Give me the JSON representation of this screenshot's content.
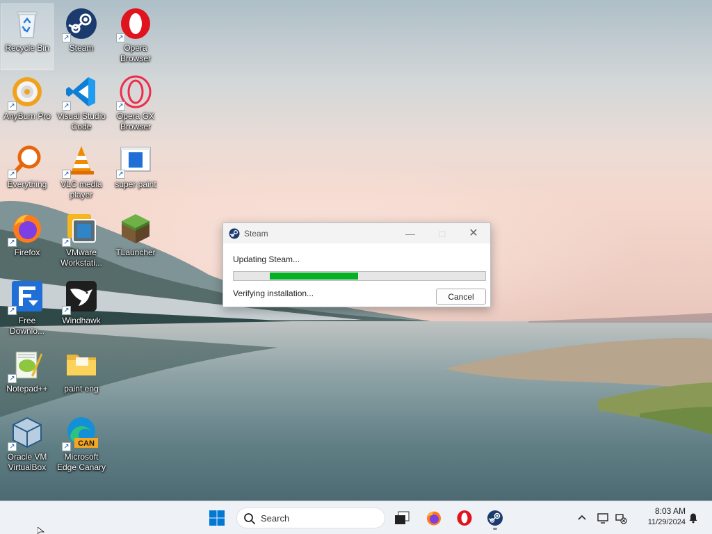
{
  "desktop_icons": [
    {
      "label": "Recycle Bin",
      "icon": "recycle-bin-icon",
      "shortcut": false
    },
    {
      "label": "Steam",
      "icon": "steam-icon",
      "shortcut": true
    },
    {
      "label": "Opera Browser",
      "icon": "opera-icon",
      "shortcut": true
    },
    {
      "label": "AnyBurn Pro",
      "icon": "anyburn-icon",
      "shortcut": true
    },
    {
      "label": "Visual Studio Code",
      "icon": "vscode-icon",
      "shortcut": true
    },
    {
      "label": "Opera GX Browser",
      "icon": "opera-gx-icon",
      "shortcut": true
    },
    {
      "label": "Everything",
      "icon": "everything-search-icon",
      "shortcut": true
    },
    {
      "label": "VLC media player",
      "icon": "vlc-icon",
      "shortcut": true
    },
    {
      "label": "super paint",
      "icon": "super-paint-icon",
      "shortcut": true
    },
    {
      "label": "Firefox",
      "icon": "firefox-icon",
      "shortcut": true
    },
    {
      "label": "VMware Workstati...",
      "icon": "vmware-icon",
      "shortcut": true
    },
    {
      "label": "TLauncher",
      "icon": "tlauncher-icon",
      "shortcut": true
    },
    {
      "label": "Free Downlo...",
      "icon": "free-download-manager-icon",
      "shortcut": true
    },
    {
      "label": "Windhawk",
      "icon": "windhawk-icon",
      "shortcut": true
    },
    {
      "label": "Notepad++",
      "icon": "notepad-plus-plus-icon",
      "shortcut": true
    },
    {
      "label": "paint eng",
      "icon": "folder-icon",
      "shortcut": false
    },
    {
      "label": "Oracle VM VirtualBox",
      "icon": "virtualbox-icon",
      "shortcut": true
    },
    {
      "label": "Microsoft Edge Canary",
      "icon": "edge-canary-icon",
      "shortcut": true,
      "badge": "CAN"
    }
  ],
  "steam_dialog": {
    "title": "Steam",
    "status": "Updating Steam...",
    "detail": "Verifying installation...",
    "cancel_label": "Cancel",
    "progress_start_fraction": 0.145,
    "progress_end_fraction": 0.495,
    "progress_color": "#06b025"
  },
  "taskbar": {
    "search_label": "Search",
    "pinned": [
      {
        "name": "start",
        "icon": "windows-start-icon"
      },
      {
        "name": "task-view",
        "icon": "task-view-icon"
      },
      {
        "name": "firefox",
        "icon": "firefox-icon"
      },
      {
        "name": "opera",
        "icon": "opera-icon"
      },
      {
        "name": "steam",
        "icon": "steam-icon",
        "running": true
      }
    ],
    "tray_icons": [
      "chevron-up-icon",
      "display-icon",
      "network-disconnected-icon",
      "bell-icon"
    ],
    "time": "8:03 AM",
    "date": "11/29/2024"
  },
  "colors": {
    "accent": "#0078d4",
    "steam_blue": "#1b2838",
    "progress_green": "#06b025",
    "taskbar_bg": "#eef1f6"
  }
}
